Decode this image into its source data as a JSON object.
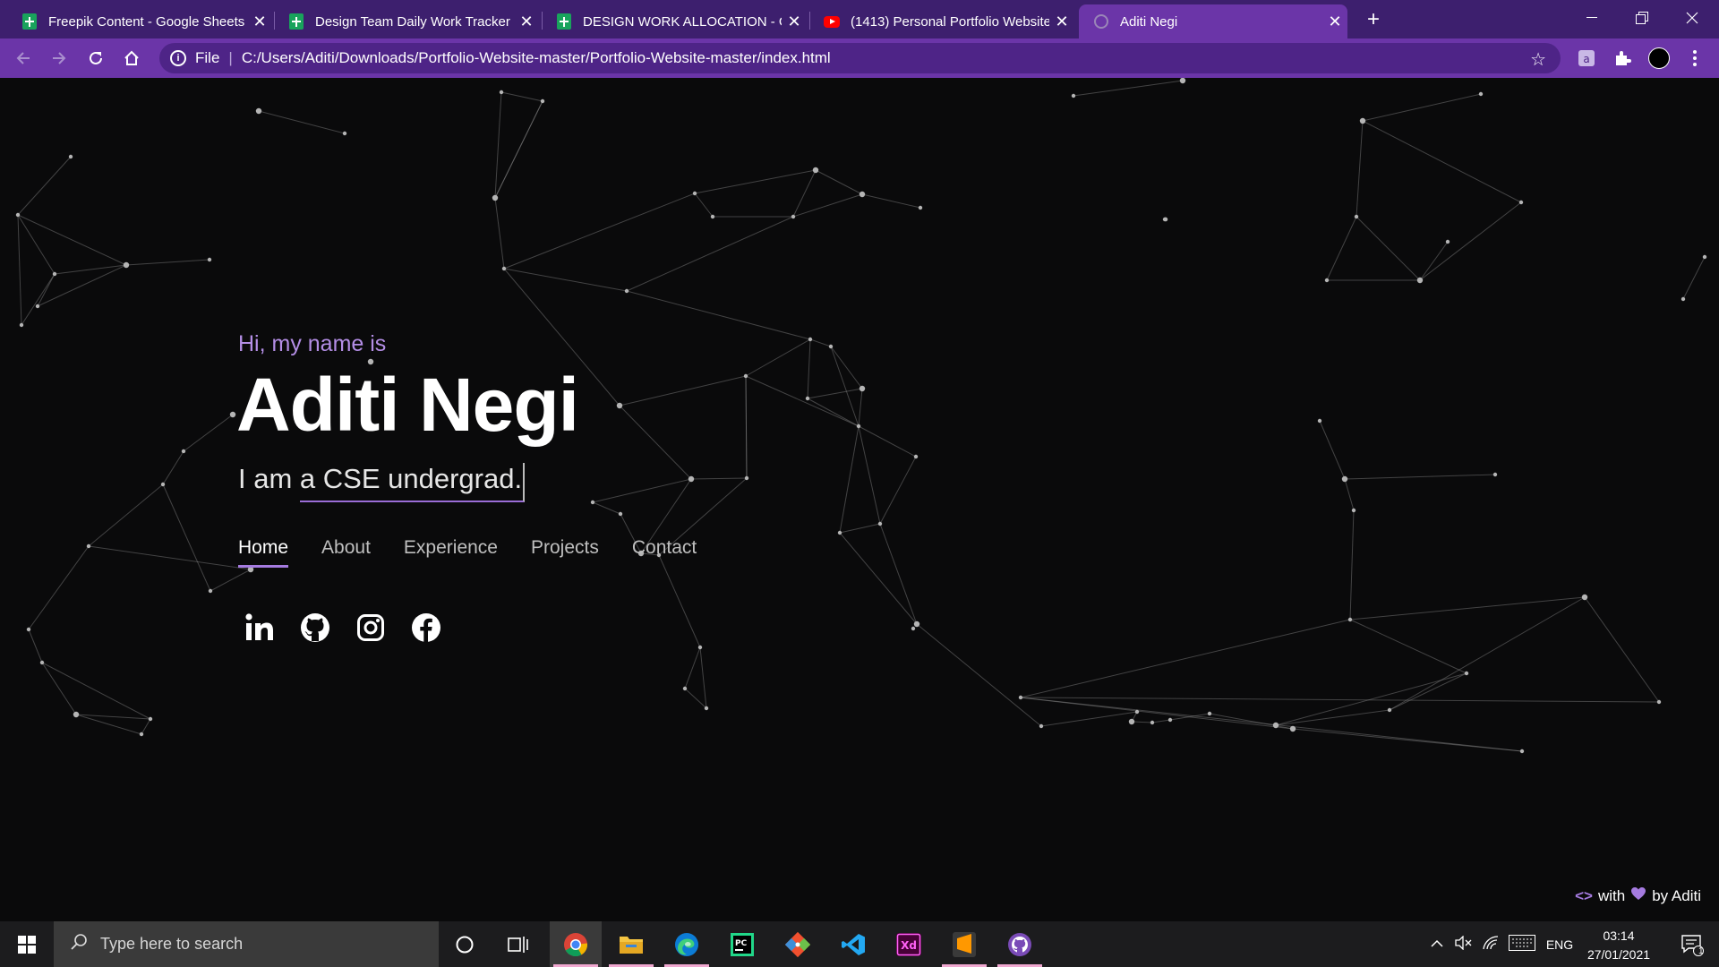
{
  "browser": {
    "tabs": [
      {
        "title": "Freepik Content - Google Sheets",
        "icon": "google-sheets-icon"
      },
      {
        "title": "Design Team Daily Work Tracker",
        "icon": "google-sheets-icon"
      },
      {
        "title": "DESIGN WORK ALLOCATION - Gc",
        "icon": "google-sheets-icon"
      },
      {
        "title": "(1413) Personal Portfolio Website",
        "icon": "youtube-icon"
      },
      {
        "title": "Aditi Negi",
        "icon": "globe-icon"
      }
    ],
    "address": {
      "scheme_label": "File",
      "url": "C:/Users/Aditi/Downloads/Portfolio-Website-master/Portfolio-Website-master/index.html"
    }
  },
  "hero": {
    "greeting": "Hi, my name is",
    "name": "Aditi Negi",
    "tagline_prefix": "I am",
    "tagline_highlight": "a CSE undergrad."
  },
  "nav": {
    "items": [
      "Home",
      "About",
      "Experience",
      "Projects",
      "Contact"
    ],
    "active": "Home"
  },
  "social": [
    "linkedin-icon",
    "github-icon",
    "instagram-icon",
    "facebook-icon"
  ],
  "footer": {
    "with_label": "with",
    "by_label": "by Aditi"
  },
  "taskbar": {
    "search_placeholder": "Type here to search",
    "apps": [
      "chrome-icon",
      "file-explorer-icon",
      "edge-icon",
      "pycharm-icon",
      "git-icon",
      "vscode-icon",
      "adobe-xd-icon",
      "sublime-text-icon",
      "github-desktop-icon"
    ],
    "language": "ENG",
    "time": "03:14",
    "date": "27/01/2021",
    "notification_count": "1"
  },
  "colors": {
    "browser_frame": "#3d1f6e",
    "browser_toolbar": "#6b35a8",
    "accent": "#a57be0",
    "page_background": "#0a0a0b"
  }
}
